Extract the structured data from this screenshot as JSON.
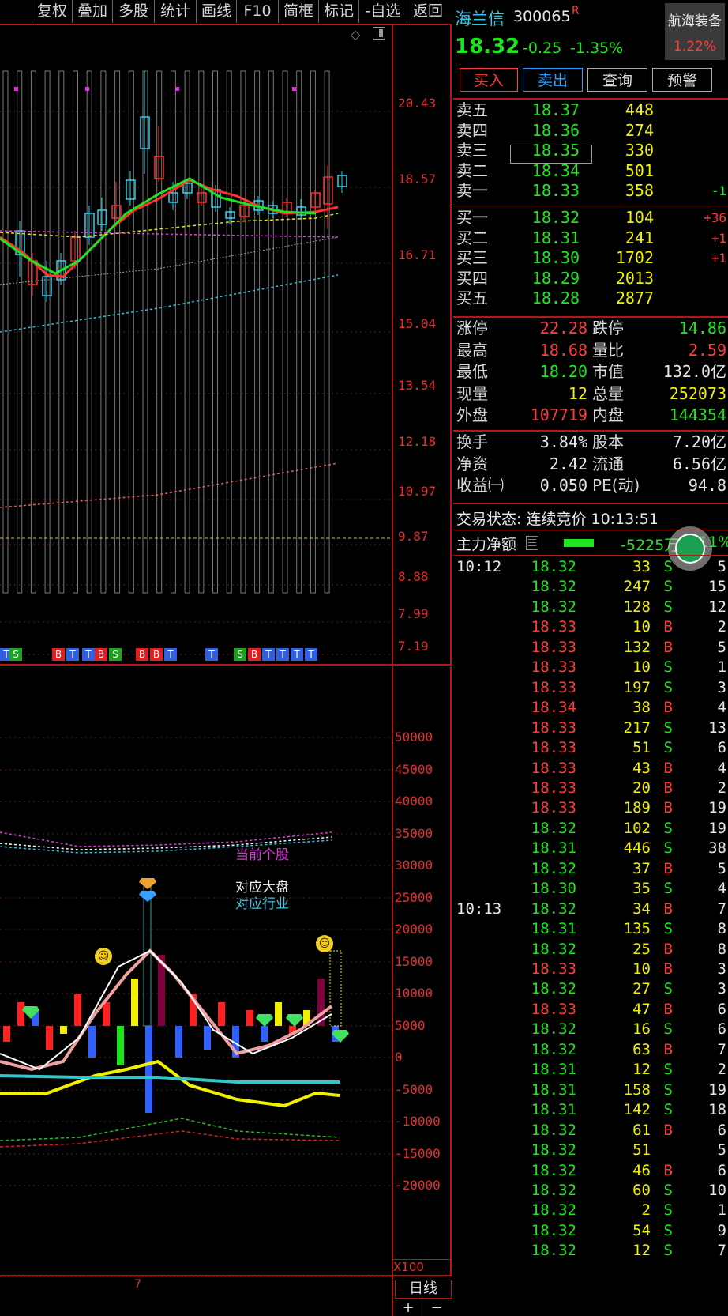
{
  "toolbar": {
    "items": [
      "复权",
      "叠加",
      "多股",
      "统计",
      "画线",
      "F10",
      "简框",
      "标记",
      "-自选",
      "返回"
    ]
  },
  "price_axis": [
    "20.43",
    "18.57",
    "16.71",
    "15.04",
    "13.54",
    "12.18",
    "10.97",
    "9.87",
    "8.88",
    "7.99",
    "7.19"
  ],
  "volume_axis": [
    "50000",
    "45000",
    "40000",
    "35000",
    "30000",
    "25000",
    "20000",
    "15000",
    "10000",
    "5000",
    "0",
    "-5000",
    "-10000",
    "-15000",
    "-20000"
  ],
  "signal_marks": [
    "T",
    "S",
    "B",
    "T",
    "T",
    "B",
    "S",
    "B",
    "B",
    "T",
    "T",
    "S",
    "B",
    "T",
    "T",
    "T",
    "T"
  ],
  "legend": {
    "current_stock": "当前个股",
    "market": "对应大盘",
    "industry": "对应行业"
  },
  "x100": "X100",
  "period": "日线",
  "bottom_axis_label": "7",
  "zoom_plus": "+",
  "zoom_minus": "−",
  "stock": {
    "name": "海兰信",
    "code": "300065",
    "flag": "R",
    "price": "18.32",
    "change": "-0.25",
    "change_pct": "-1.35%",
    "sector": "航海装备",
    "sector_pct": "1.22%"
  },
  "actions": {
    "buy": "买入",
    "sell": "卖出",
    "query": "查询",
    "alert": "预警"
  },
  "asks": [
    {
      "label": "卖五",
      "price": "18.37",
      "vol": "448",
      "chg": ""
    },
    {
      "label": "卖四",
      "price": "18.36",
      "vol": "274",
      "chg": ""
    },
    {
      "label": "卖三",
      "price": "18.35",
      "vol": "330",
      "chg": ""
    },
    {
      "label": "卖二",
      "price": "18.34",
      "vol": "501",
      "chg": ""
    },
    {
      "label": "卖一",
      "price": "18.33",
      "vol": "358",
      "chg": "-1"
    }
  ],
  "bids": [
    {
      "label": "买一",
      "price": "18.32",
      "vol": "104",
      "chg": "+36"
    },
    {
      "label": "买二",
      "price": "18.31",
      "vol": "241",
      "chg": "+1"
    },
    {
      "label": "买三",
      "price": "18.30",
      "vol": "1702",
      "chg": "+1"
    },
    {
      "label": "买四",
      "price": "18.29",
      "vol": "2013",
      "chg": ""
    },
    {
      "label": "买五",
      "price": "18.28",
      "vol": "2877",
      "chg": ""
    }
  ],
  "stats1": [
    {
      "l1": "涨停",
      "v1": "22.28",
      "c1": "r",
      "l2": "跌停",
      "v2": "14.86",
      "c2": "g"
    },
    {
      "l1": "最高",
      "v1": "18.68",
      "c1": "r",
      "l2": "量比",
      "v2": "2.59",
      "c2": "r"
    },
    {
      "l1": "最低",
      "v1": "18.20",
      "c1": "g",
      "l2": "市值",
      "v2": "132.0亿",
      "c2": "w"
    },
    {
      "l1": "现量",
      "v1": "12",
      "c1": "y",
      "l2": "总量",
      "v2": "252073",
      "c2": "y"
    },
    {
      "l1": "外盘",
      "v1": "107719",
      "c1": "r",
      "l2": "内盘",
      "v2": "144354",
      "c2": "g"
    }
  ],
  "stats2": [
    {
      "l1": "换手",
      "v1": "3.84%",
      "c1": "w",
      "l2": "股本",
      "v2": "7.20亿",
      "c2": "w"
    },
    {
      "l1": "净资",
      "v1": "2.42",
      "c1": "w",
      "l2": "流通",
      "v2": "6.56亿",
      "c2": "w"
    },
    {
      "l1": "收益㈠",
      "v1": "0.050",
      "c1": "w",
      "l2": "PE(动)",
      "v2": "94.8",
      "c2": "w"
    }
  ],
  "trade_status": "交易状态: 连续竞价 10:13:51",
  "main_net": {
    "label": "主力净额",
    "value": "-5225万",
    "pct": "-11%"
  },
  "ticks": [
    {
      "t": "10:12",
      "p": "18.32",
      "v": "33",
      "d": "S",
      "n": "5"
    },
    {
      "t": "",
      "p": "18.32",
      "v": "247",
      "d": "S",
      "n": "15"
    },
    {
      "t": "",
      "p": "18.32",
      "v": "128",
      "d": "S",
      "n": "12"
    },
    {
      "t": "",
      "p": "18.33",
      "v": "10",
      "d": "B",
      "n": "2"
    },
    {
      "t": "",
      "p": "18.33",
      "v": "132",
      "d": "B",
      "n": "5"
    },
    {
      "t": "",
      "p": "18.33",
      "v": "10",
      "d": "S",
      "n": "1"
    },
    {
      "t": "",
      "p": "18.33",
      "v": "197",
      "d": "S",
      "n": "3"
    },
    {
      "t": "",
      "p": "18.34",
      "v": "38",
      "d": "B",
      "n": "4"
    },
    {
      "t": "",
      "p": "18.33",
      "v": "217",
      "d": "S",
      "n": "13"
    },
    {
      "t": "",
      "p": "18.33",
      "v": "51",
      "d": "S",
      "n": "6"
    },
    {
      "t": "",
      "p": "18.33",
      "v": "43",
      "d": "B",
      "n": "4"
    },
    {
      "t": "",
      "p": "18.33",
      "v": "20",
      "d": "B",
      "n": "2"
    },
    {
      "t": "",
      "p": "18.33",
      "v": "189",
      "d": "B",
      "n": "19"
    },
    {
      "t": "",
      "p": "18.32",
      "v": "102",
      "d": "S",
      "n": "19"
    },
    {
      "t": "",
      "p": "18.31",
      "v": "446",
      "d": "S",
      "n": "38"
    },
    {
      "t": "",
      "p": "18.32",
      "v": "37",
      "d": "B",
      "n": "5"
    },
    {
      "t": "",
      "p": "18.30",
      "v": "35",
      "d": "S",
      "n": "4"
    },
    {
      "t": "10:13",
      "p": "18.32",
      "v": "34",
      "d": "B",
      "n": "7"
    },
    {
      "t": "",
      "p": "18.31",
      "v": "135",
      "d": "S",
      "n": "8"
    },
    {
      "t": "",
      "p": "18.32",
      "v": "25",
      "d": "B",
      "n": "8"
    },
    {
      "t": "",
      "p": "18.33",
      "v": "10",
      "d": "B",
      "n": "3"
    },
    {
      "t": "",
      "p": "18.32",
      "v": "27",
      "d": "S",
      "n": "3"
    },
    {
      "t": "",
      "p": "18.33",
      "v": "47",
      "d": "B",
      "n": "6"
    },
    {
      "t": "",
      "p": "18.32",
      "v": "16",
      "d": "S",
      "n": "6"
    },
    {
      "t": "",
      "p": "18.32",
      "v": "63",
      "d": "B",
      "n": "7"
    },
    {
      "t": "",
      "p": "18.31",
      "v": "12",
      "d": "S",
      "n": "2"
    },
    {
      "t": "",
      "p": "18.31",
      "v": "158",
      "d": "S",
      "n": "19"
    },
    {
      "t": "",
      "p": "18.31",
      "v": "142",
      "d": "S",
      "n": "18"
    },
    {
      "t": "",
      "p": "18.32",
      "v": "61",
      "d": "B",
      "n": "6"
    },
    {
      "t": "",
      "p": "18.32",
      "v": "51",
      "d": "",
      "n": "5"
    },
    {
      "t": "",
      "p": "18.32",
      "v": "46",
      "d": "B",
      "n": "6"
    },
    {
      "t": "",
      "p": "18.32",
      "v": "60",
      "d": "S",
      "n": "10"
    },
    {
      "t": "",
      "p": "18.32",
      "v": "2",
      "d": "S",
      "n": "1"
    },
    {
      "t": "",
      "p": "18.32",
      "v": "54",
      "d": "S",
      "n": "9"
    },
    {
      "t": "",
      "p": "18.32",
      "v": "12",
      "d": "S",
      "n": "7"
    }
  ],
  "colors": {
    "red": "#ff3c3c",
    "green": "#1ee61e",
    "yellow": "#f0f000",
    "frame": "#b01818",
    "cyan": "#30c8e8"
  }
}
